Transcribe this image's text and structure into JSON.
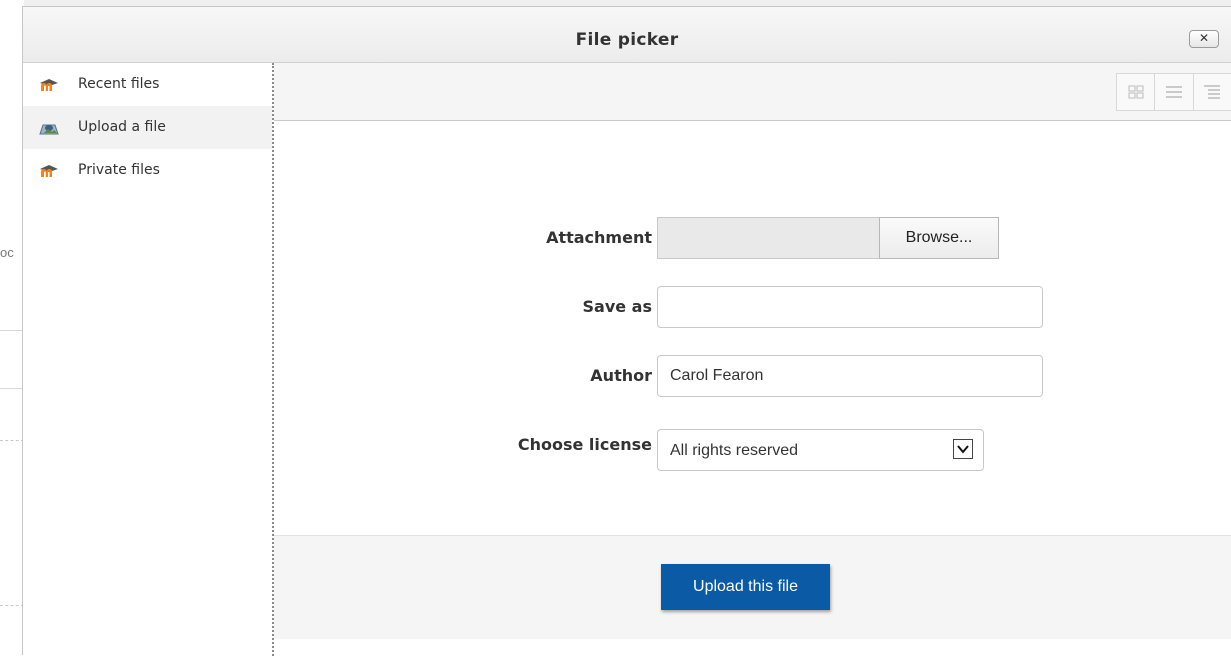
{
  "dialog": {
    "title": "File picker",
    "close_label": "✕"
  },
  "background": {
    "edge_text": "oc"
  },
  "sidebar": {
    "items": [
      {
        "label": "Recent files",
        "icon": "moodle-icon",
        "active": false
      },
      {
        "label": "Upload a file",
        "icon": "upload-icon",
        "active": true
      },
      {
        "label": "Private files",
        "icon": "moodle-icon",
        "active": false
      }
    ]
  },
  "toolbar": {
    "view_buttons": [
      "icons-view-icon",
      "list-view-icon",
      "tree-view-icon"
    ]
  },
  "form": {
    "attachment_label": "Attachment",
    "browse_label": "Browse...",
    "save_as_label": "Save as",
    "save_as_value": "",
    "author_label": "Author",
    "author_value": "Carol Fearon",
    "license_label": "Choose license",
    "license_value": "All rights reserved"
  },
  "footer": {
    "upload_label": "Upload this file"
  },
  "colors": {
    "primary_button": "#0a5aa6",
    "moodle_orange": "#f98012"
  }
}
